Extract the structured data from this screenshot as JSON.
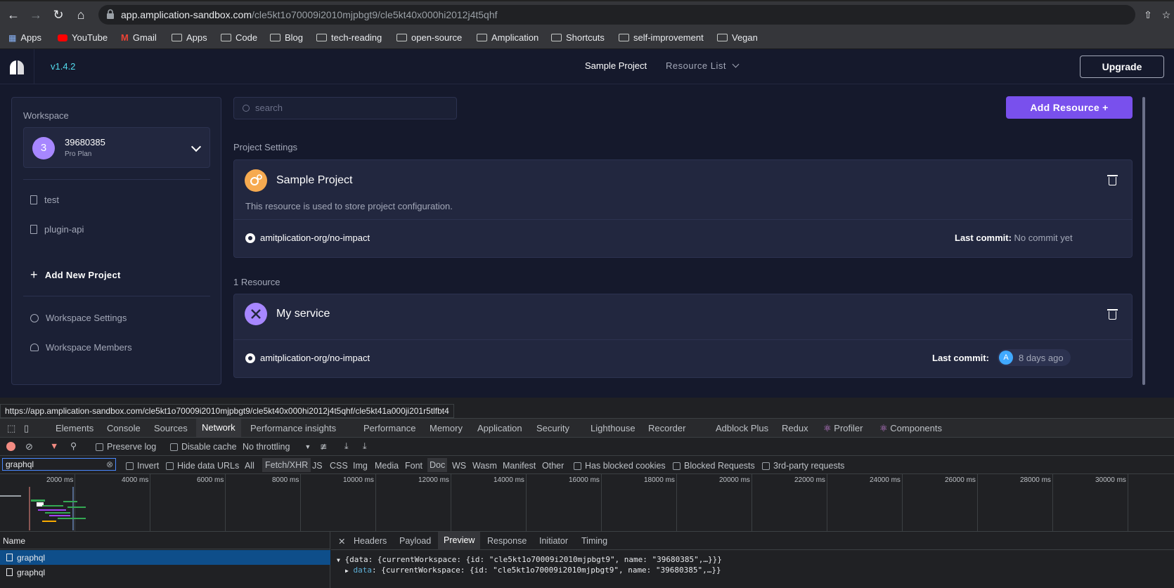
{
  "browser": {
    "url_host": "app.amplication-sandbox.com",
    "url_path": "/cle5kt1o70009i2010mjpbgt9/cle5kt40x000hi2012j4t5qhf",
    "bookmarks": [
      "Apps",
      "YouTube",
      "Gmail",
      "Apps",
      "Code",
      "Blog",
      "tech-reading",
      "open-source",
      "Amplication",
      "Shortcuts",
      "self-improvement",
      "Vegan"
    ],
    "status_url": "https://app.amplication-sandbox.com/cle5kt1o70009i2010mjpbgt9/cle5kt40x000hi2012j4t5qhf/cle5kt41a000ji201r5tlfbt4"
  },
  "header": {
    "version": "v1.4.2",
    "project": "Sample Project",
    "resource_list": "Resource List",
    "upgrade": "Upgrade"
  },
  "sidebar": {
    "workspace_label": "Workspace",
    "workspace_initial": "3",
    "workspace_name": "39680385",
    "workspace_plan": "Pro Plan",
    "projects": [
      "test",
      "plugin-api"
    ],
    "add_project": "Add New Project",
    "settings": "Workspace Settings",
    "members": "Workspace Members"
  },
  "main": {
    "search_placeholder": "search",
    "add_resource": "Add Resource",
    "project_settings_label": "Project Settings",
    "project_card": {
      "title": "Sample Project",
      "description": "This resource is used to store project configuration.",
      "repo": "amitplication-org/no-impact",
      "last_commit_label": "Last commit:",
      "last_commit_value": "No commit yet"
    },
    "resources_count": "1 Resource",
    "service_card": {
      "title": "My service",
      "repo": "amitplication-org/no-impact",
      "last_commit_label": "Last commit:",
      "avatar": "A",
      "last_commit_value": "8 days ago"
    }
  },
  "devtools": {
    "tabs": [
      "Elements",
      "Console",
      "Sources",
      "Network",
      "Performance insights",
      "Performance",
      "Memory",
      "Application",
      "Security",
      "Lighthouse",
      "Recorder",
      "Adblock Plus",
      "Redux",
      "Profiler",
      "Components"
    ],
    "active_tab": "Network",
    "preserve_log": "Preserve log",
    "disable_cache": "Disable cache",
    "throttling": "No throttling",
    "filter_value": "graphql",
    "invert": "Invert",
    "hide_data_urls": "Hide data URLs",
    "types": [
      "All",
      "Fetch/XHR",
      "JS",
      "CSS",
      "Img",
      "Media",
      "Font",
      "Doc",
      "WS",
      "Wasm",
      "Manifest",
      "Other"
    ],
    "has_blocked_cookies": "Has blocked cookies",
    "blocked_requests": "Blocked Requests",
    "third_party": "3rd-party requests",
    "ticks": [
      "2000 ms",
      "4000 ms",
      "6000 ms",
      "8000 ms",
      "10000 ms",
      "12000 ms",
      "14000 ms",
      "16000 ms",
      "18000 ms",
      "20000 ms",
      "22000 ms",
      "24000 ms",
      "26000 ms",
      "28000 ms",
      "30000 ms"
    ],
    "name_header": "Name",
    "requests": [
      "graphql",
      "graphql"
    ],
    "panel_tabs": [
      "Headers",
      "Payload",
      "Preview",
      "Response",
      "Initiator",
      "Timing"
    ],
    "active_panel_tab": "Preview",
    "json_line1": "{data: {currentWorkspace: {id: \"cle5kt1o70009i2010mjpbgt9\", name: \"39680385\",…}}}",
    "json_line2_key": "data",
    "json_line2_rest": ": {currentWorkspace: {id: \"cle5kt1o70009i2010mjpbgt9\", name: \"39680385\",…}}"
  }
}
